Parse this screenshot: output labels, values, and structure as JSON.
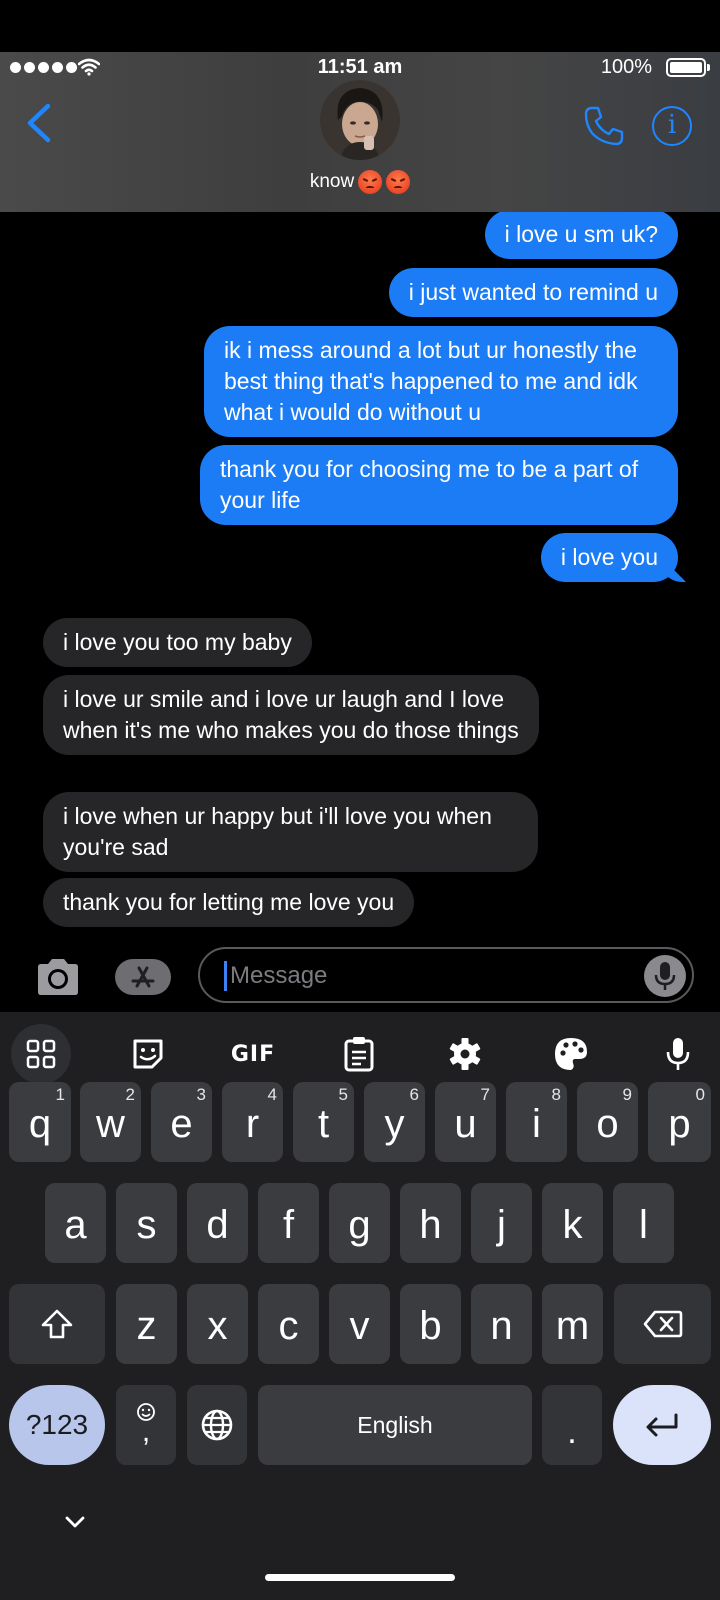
{
  "status_bar": {
    "time": "11:51 am",
    "battery_percent": "100%",
    "signal_bars": 5,
    "battery_level": 1.0
  },
  "header": {
    "contact_name": "know",
    "contact_emojis": [
      "angry-face",
      "angry-face"
    ],
    "back_icon": "chevron-left-icon",
    "call_icon": "phone-icon",
    "info_icon": "info-icon",
    "accent_color": "#1e86ff"
  },
  "messages": [
    {
      "direction": "sent",
      "text": "i love u sm uk?"
    },
    {
      "direction": "sent",
      "text": "i just wanted to remind u"
    },
    {
      "direction": "sent",
      "text": "ik i mess around a lot but ur honestly the best thing that's happened to me and idk what i would do without u"
    },
    {
      "direction": "sent",
      "text": "thank you for choosing me to be a part of your life"
    },
    {
      "direction": "sent",
      "text": "i love you"
    },
    {
      "direction": "received",
      "text": "i love you too my baby"
    },
    {
      "direction": "received",
      "text": "i love ur smile and i love ur laugh and I love when it's me who makes you do those things"
    },
    {
      "direction": "received",
      "text": "i love when ur happy but i'll love you when you're sad"
    },
    {
      "direction": "received",
      "text": "thank you for letting me love you"
    }
  ],
  "input_bar": {
    "placeholder": "Message",
    "camera_icon": "camera-icon",
    "apps_icon": "app-store-icon",
    "mic_icon": "microphone-icon"
  },
  "keyboard": {
    "toolbar": [
      "apps-grid-icon",
      "sticker-icon",
      "GIF",
      "clipboard-icon",
      "gear-icon",
      "palette-icon",
      "microphone-icon"
    ],
    "gif_label": "GIF",
    "row1": [
      {
        "key": "q",
        "hint": "1"
      },
      {
        "key": "w",
        "hint": "2"
      },
      {
        "key": "e",
        "hint": "3"
      },
      {
        "key": "r",
        "hint": "4"
      },
      {
        "key": "t",
        "hint": "5"
      },
      {
        "key": "y",
        "hint": "6"
      },
      {
        "key": "u",
        "hint": "7"
      },
      {
        "key": "i",
        "hint": "8"
      },
      {
        "key": "o",
        "hint": "9"
      },
      {
        "key": "p",
        "hint": "0"
      }
    ],
    "row2": [
      "a",
      "s",
      "d",
      "f",
      "g",
      "h",
      "j",
      "k",
      "l"
    ],
    "row3": [
      "z",
      "x",
      "c",
      "v",
      "b",
      "n",
      "m"
    ],
    "symbols_label": "?123",
    "comma_label": ",",
    "space_label": "English",
    "period_label": ".",
    "sym_key_color": "#b7c6ea",
    "enter_key_color": "#dbe3fb"
  }
}
